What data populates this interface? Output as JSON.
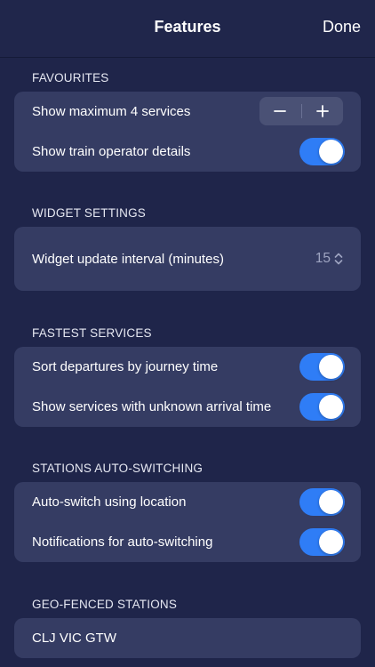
{
  "header": {
    "title": "Features",
    "done_label": "Done"
  },
  "favourites": {
    "title": "FAVOURITES",
    "show_max_label": "Show maximum 4 services",
    "operator_label": "Show train operator details",
    "operator_on": true
  },
  "widget": {
    "title": "WIDGET SETTINGS",
    "interval_label": "Widget update interval (minutes)",
    "interval_value": "15"
  },
  "fastest": {
    "title": "FASTEST SERVICES",
    "sort_label": "Sort departures by journey time",
    "sort_on": true,
    "unknown_label": "Show services with unknown arrival time",
    "unknown_on": true
  },
  "autoswitch": {
    "title": "STATIONS AUTO-SWITCHING",
    "location_label": "Auto-switch using location",
    "location_on": true,
    "notify_label": "Notifications for auto-switching",
    "notify_on": true
  },
  "geofenced": {
    "title": "GEO-FENCED STATIONS",
    "stations": "CLJ VIC GTW"
  },
  "colors": {
    "background": "#1f254a",
    "card": "#353c63",
    "accent": "#2f7df6"
  }
}
